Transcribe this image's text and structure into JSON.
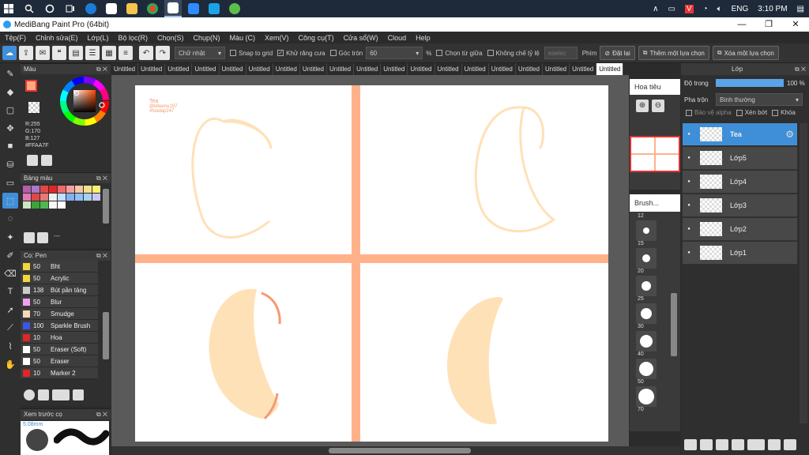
{
  "taskbar": {
    "tray": {
      "lang": "ENG",
      "time": "3:10 PM"
    }
  },
  "window": {
    "title": "MediBang Paint Pro (64bit)",
    "controls": [
      "—",
      "❐",
      "✕"
    ]
  },
  "menu": [
    "Tệp(F)",
    "Chỉnh sửa(E)",
    "Lớp(L)",
    "Bộ lọc(R)",
    "Chọn(S)",
    "Chụp(N)",
    "Màu (C)",
    "Xem(V)",
    "Công cụ(T)",
    "Cửa sổ(W)",
    "Cloud",
    "Help"
  ],
  "toolbar": {
    "shape_select": "Chữ nhật",
    "snap": "Snap to grid",
    "antialias": "Khử răng cưa",
    "corner": "Góc tròn",
    "corner_value": "60",
    "percent": "%",
    "center_select": "Chọn từ giữa",
    "ratio": "Không chế tỷ lệ",
    "misc": "eselec",
    "key_label": "Phím",
    "reset": "Đặt lại",
    "add_selection": "Thêm một lựa chọn",
    "remove_selection": "Xóa một lựa chọn"
  },
  "color_panel": {
    "title": "Màu",
    "r": "R:255",
    "g": "G:170",
    "b": "B:127",
    "hex": "#FFAA7F",
    "primary": "#FFAA7F",
    "secondary": "#FFFFFF"
  },
  "palette_panel": {
    "title": "Bảng màu",
    "colors": [
      "#b05fa8",
      "#a879c9",
      "#e04848",
      "#e02626",
      "#f06a6a",
      "#f4a0a0",
      "#f7c6a3",
      "#f5e08c",
      "#f9ef74",
      "#e07ab2",
      "#e04848",
      "#e47a7a",
      "#f0f0f0",
      "#c0e0ff",
      "#80b0f0",
      "#90c0f8",
      "#a8d0f0",
      "#c8c8f8",
      "#c8e8c0",
      "#3aa33a",
      "#50b850",
      "#f8f8f8",
      "#ffffff"
    ]
  },
  "brush_panel": {
    "title": "Cọ: Pen",
    "items": [
      {
        "size": "50",
        "name": "Bht",
        "color": "#f3d63a"
      },
      {
        "size": "50",
        "name": "Acrylic",
        "color": "#f3d63a"
      },
      {
        "size": "138",
        "name": "Bút pần tảng",
        "color": "#cccccc"
      },
      {
        "size": "50",
        "name": "Blur",
        "color": "#f4a0f0"
      },
      {
        "size": "70",
        "name": "Smudge",
        "color": "#f7d8b8"
      },
      {
        "size": "100",
        "name": "Sparkle Brush",
        "color": "#3a58e0"
      },
      {
        "size": "10",
        "name": "Hoa",
        "color": "#e02626"
      },
      {
        "size": "50",
        "name": "Eraser (Soft)",
        "color": "#ffffff"
      },
      {
        "size": "50",
        "name": "Eraser",
        "color": "#ffffff"
      },
      {
        "size": "10",
        "name": "Marker 2",
        "color": "#e02626"
      }
    ]
  },
  "preview_panel": {
    "title": "Xem trước cọ",
    "size": "5.08mm"
  },
  "tabs": [
    "Untitled",
    "Untitled",
    "Untitled",
    "Untitled",
    "Untitled",
    "Untitled",
    "Untitled",
    "Untitled",
    "Untitled",
    "Untitled",
    "Untitled",
    "Untitled",
    "Untitled",
    "Untitled",
    "Untitled",
    "Untitled",
    "Untitled",
    "Untitled",
    "Untitled"
  ],
  "canvas": {
    "watermark": [
      "Tea",
      "@kiteenu197",
      "#hoidap247"
    ],
    "cross_color": "#ffb28a",
    "fill_color": "#ffe1b8",
    "stroke_color": "#ffe1b8"
  },
  "navigator": {
    "title": "Hoa tiêu"
  },
  "brush_size_panel": {
    "title": "Brush...",
    "sizes": [
      "12",
      "15",
      "20",
      "25",
      "30",
      "40",
      "50",
      "70"
    ]
  },
  "layer_panel": {
    "title": "Lớp",
    "opacity_label": "Độ trong",
    "opacity": "100 %",
    "blend_label": "Pha trộn",
    "blend": "Bình thường",
    "alpha": "Bảo vệ alpha",
    "clip": "Xén bớt",
    "lock": "Khóa",
    "layers": [
      "Tea",
      "Lớp5",
      "Lớp4",
      "Lớp3",
      "Lớp2",
      "Lớp1"
    ]
  }
}
